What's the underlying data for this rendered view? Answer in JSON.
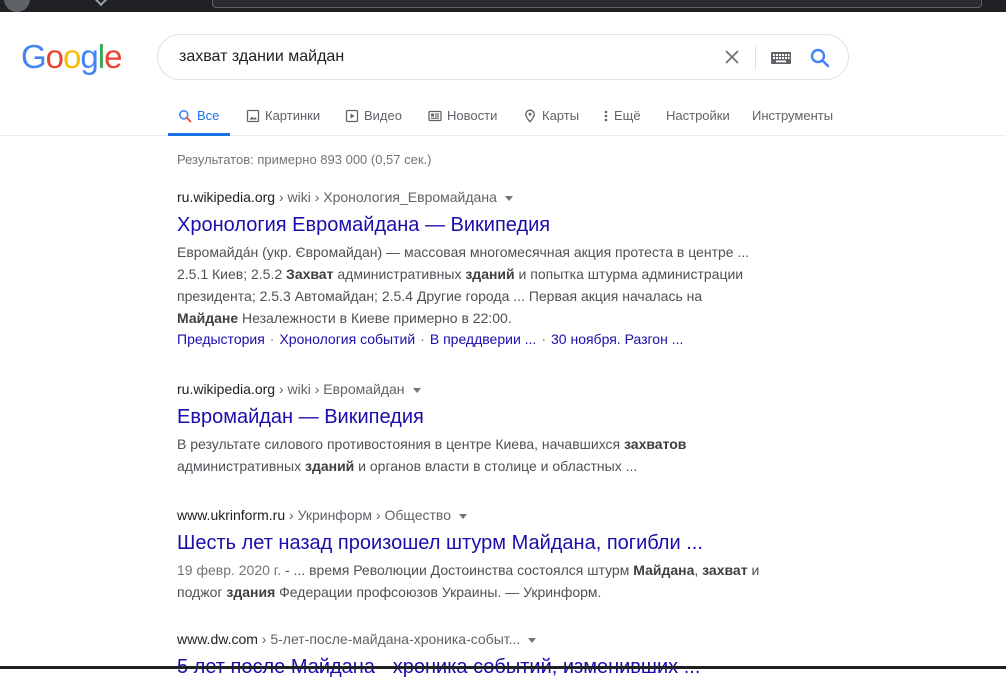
{
  "logo": {
    "letters": [
      "G",
      "o",
      "o",
      "g",
      "l",
      "e"
    ],
    "colors": [
      "#4285f4",
      "#ea4335",
      "#fbbc05",
      "#4285f4",
      "#34a853",
      "#ea4335"
    ]
  },
  "search": {
    "query": "захват здании майдан"
  },
  "tabs": [
    {
      "label": "Все",
      "icon": "search-icon",
      "active": true
    },
    {
      "label": "Картинки",
      "icon": "image-icon"
    },
    {
      "label": "Видео",
      "icon": "video-icon"
    },
    {
      "label": "Новости",
      "icon": "news-icon"
    },
    {
      "label": "Карты",
      "icon": "map-pin-icon"
    },
    {
      "label": "Ещё",
      "icon": "more-vert-icon"
    },
    {
      "label": "Настройки"
    },
    {
      "label": "Инструменты"
    }
  ],
  "stats": "Результатов: примерно 893 000 (0,57 сек.)",
  "results": [
    {
      "domain": "ru.wikipedia.org",
      "path": " › wiki › Хронология_Евромайдана",
      "title": "Хронология Евромайдана — Википедия",
      "snippet_lines": [
        [
          {
            "t": "Евромайда́н (укр. Євромайдан) — массовая многомесячная акция протеста в центре ..."
          }
        ],
        [
          {
            "t": "2.5.1 Киев; 2.5.2 "
          },
          {
            "t": "Захват",
            "b": true
          },
          {
            "t": " административных "
          },
          {
            "t": "зданий",
            "b": true
          },
          {
            "t": " и попытка штурма администрации"
          }
        ],
        [
          {
            "t": "президента; 2.5.3 Автомайдан; 2.5.4 Другие города ... Первая акция началась на"
          }
        ],
        [
          {
            "t": "Майдане",
            "b": true
          },
          {
            "t": " Незалежности в Киеве примерно в 22:00."
          }
        ]
      ],
      "sitelinks": [
        "Предыстория",
        "Хронология событий",
        "В преддверии ...",
        "30 ноября. Разгон ..."
      ]
    },
    {
      "domain": "ru.wikipedia.org",
      "path": " › wiki › Евромайдан",
      "title": "Евромайдан — Википедия",
      "snippet_lines": [
        [
          {
            "t": "В результате силового противостояния в центре Киева, начавшихся "
          },
          {
            "t": "захватов",
            "b": true
          }
        ],
        [
          {
            "t": "административных "
          },
          {
            "t": "зданий",
            "b": true
          },
          {
            "t": " и органов власти в столице и областных ..."
          }
        ]
      ]
    },
    {
      "domain": "www.ukrinform.ru",
      "path": " › Укринформ › Общество",
      "title": "Шесть лет назад произошел штурм Майдана, погибли ...",
      "snippet_lines": [
        [
          {
            "t": "19 февр. 2020 г.",
            "muted": true
          },
          {
            "t": " - ... время Революции Достоинства состоялся штурм "
          },
          {
            "t": "Майдана",
            "b": true
          },
          {
            "t": ", "
          },
          {
            "t": "захват",
            "b": true
          },
          {
            "t": " и"
          }
        ],
        [
          {
            "t": "поджог "
          },
          {
            "t": "здания",
            "b": true
          },
          {
            "t": " Федерации профсоюзов Украины. — Укринформ."
          }
        ]
      ]
    },
    {
      "domain": "www.dw.com",
      "path": " › 5-лет-после-майдана-хроника-событ...",
      "title": "5 лет после Майдана - хроника событий, изменивших ..."
    }
  ]
}
